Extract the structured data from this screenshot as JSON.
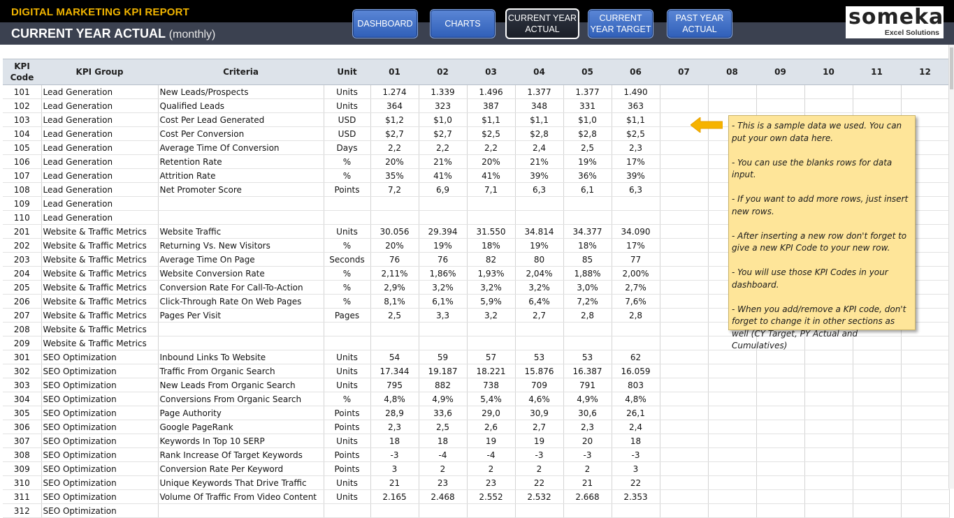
{
  "header": {
    "report_title": "DIGITAL MARKETING KPI REPORT",
    "page_title": "CURRENT YEAR ACTUAL",
    "page_title_suffix": "(monthly)"
  },
  "nav": [
    {
      "label": "DASHBOARD",
      "active": false
    },
    {
      "label": "CHARTS",
      "active": false
    },
    {
      "label": "CURRENT YEAR ACTUAL",
      "active": true
    },
    {
      "label": "CURRENT YEAR TARGET",
      "active": false
    },
    {
      "label": "PAST YEAR ACTUAL",
      "active": false
    }
  ],
  "logo": {
    "word": "someka",
    "tagline": "Excel Solutions"
  },
  "columns": {
    "code": "KPI Code",
    "group": "KPI Group",
    "criteria": "Criteria",
    "unit": "Unit",
    "months": [
      "01",
      "02",
      "03",
      "04",
      "05",
      "06",
      "07",
      "08",
      "09",
      "10",
      "11",
      "12"
    ]
  },
  "rows": [
    {
      "code": "101",
      "group": "Lead Generation",
      "criteria": "New Leads/Prospects",
      "unit": "Units",
      "values": [
        "1.274",
        "1.339",
        "1.496",
        "1.377",
        "1.377",
        "1.490"
      ]
    },
    {
      "code": "102",
      "group": "Lead Generation",
      "criteria": "Qualified Leads",
      "unit": "Units",
      "values": [
        "364",
        "323",
        "387",
        "348",
        "331",
        "363"
      ]
    },
    {
      "code": "103",
      "group": "Lead Generation",
      "criteria": "Cost Per Lead Generated",
      "unit": "USD",
      "values": [
        "$1,2",
        "$1,0",
        "$1,1",
        "$1,1",
        "$1,0",
        "$1,1"
      ]
    },
    {
      "code": "104",
      "group": "Lead Generation",
      "criteria": "Cost Per Conversion",
      "unit": "USD",
      "values": [
        "$2,7",
        "$2,7",
        "$2,5",
        "$2,8",
        "$2,8",
        "$2,5"
      ]
    },
    {
      "code": "105",
      "group": "Lead Generation",
      "criteria": "Average Time Of Conversion",
      "unit": "Days",
      "values": [
        "2,2",
        "2,2",
        "2,2",
        "2,4",
        "2,5",
        "2,3"
      ]
    },
    {
      "code": "106",
      "group": "Lead Generation",
      "criteria": "Retention Rate",
      "unit": "%",
      "values": [
        "20%",
        "21%",
        "20%",
        "21%",
        "19%",
        "17%"
      ]
    },
    {
      "code": "107",
      "group": "Lead Generation",
      "criteria": "Attrition Rate",
      "unit": "%",
      "values": [
        "35%",
        "41%",
        "41%",
        "39%",
        "36%",
        "39%"
      ]
    },
    {
      "code": "108",
      "group": "Lead Generation",
      "criteria": "Net Promoter Score",
      "unit": "Points",
      "values": [
        "7,2",
        "6,9",
        "7,1",
        "6,3",
        "6,1",
        "6,3"
      ]
    },
    {
      "code": "109",
      "group": "Lead Generation",
      "criteria": "",
      "unit": "",
      "values": [
        "",
        "",
        "",
        "",
        "",
        ""
      ]
    },
    {
      "code": "110",
      "group": "Lead Generation",
      "criteria": "",
      "unit": "",
      "values": [
        "",
        "",
        "",
        "",
        "",
        ""
      ]
    },
    {
      "code": "201",
      "group": "Website & Traffic Metrics",
      "criteria": "Website Traffic",
      "unit": "Units",
      "values": [
        "30.056",
        "29.394",
        "31.550",
        "34.814",
        "34.377",
        "34.090"
      ]
    },
    {
      "code": "202",
      "group": "Website & Traffic Metrics",
      "criteria": "Returning Vs. New Visitors",
      "unit": "%",
      "values": [
        "20%",
        "19%",
        "18%",
        "19%",
        "18%",
        "17%"
      ]
    },
    {
      "code": "203",
      "group": "Website & Traffic Metrics",
      "criteria": "Average Time On Page",
      "unit": "Seconds",
      "values": [
        "76",
        "76",
        "82",
        "80",
        "85",
        "77"
      ]
    },
    {
      "code": "204",
      "group": "Website & Traffic Metrics",
      "criteria": "Website Conversion Rate",
      "unit": "%",
      "values": [
        "2,11%",
        "1,86%",
        "1,93%",
        "2,04%",
        "1,88%",
        "2,00%"
      ]
    },
    {
      "code": "205",
      "group": "Website & Traffic Metrics",
      "criteria": "Conversion Rate For Call-To-Action",
      "unit": "%",
      "values": [
        "2,9%",
        "3,2%",
        "3,2%",
        "3,2%",
        "3,0%",
        "2,7%"
      ]
    },
    {
      "code": "206",
      "group": "Website & Traffic Metrics",
      "criteria": "Click-Through Rate On Web Pages",
      "unit": "%",
      "values": [
        "8,1%",
        "6,1%",
        "5,9%",
        "6,4%",
        "7,2%",
        "7,6%"
      ]
    },
    {
      "code": "207",
      "group": "Website & Traffic Metrics",
      "criteria": "Pages Per Visit",
      "unit": "Pages",
      "values": [
        "2,5",
        "3,3",
        "3,2",
        "2,7",
        "2,8",
        "2,8"
      ]
    },
    {
      "code": "208",
      "group": "Website & Traffic Metrics",
      "criteria": "",
      "unit": "",
      "values": [
        "",
        "",
        "",
        "",
        "",
        ""
      ]
    },
    {
      "code": "209",
      "group": "Website & Traffic Metrics",
      "criteria": "",
      "unit": "",
      "values": [
        "",
        "",
        "",
        "",
        "",
        ""
      ]
    },
    {
      "code": "301",
      "group": "SEO Optimization",
      "criteria": "Inbound Links To Website",
      "unit": "Units",
      "values": [
        "54",
        "59",
        "57",
        "53",
        "53",
        "62"
      ]
    },
    {
      "code": "302",
      "group": "SEO Optimization",
      "criteria": "Traffic From Organic Search",
      "unit": "Units",
      "values": [
        "17.344",
        "19.187",
        "18.221",
        "15.876",
        "16.387",
        "16.059"
      ]
    },
    {
      "code": "303",
      "group": "SEO Optimization",
      "criteria": "New Leads From Organic Search",
      "unit": "Units",
      "values": [
        "795",
        "882",
        "738",
        "709",
        "791",
        "803"
      ]
    },
    {
      "code": "304",
      "group": "SEO Optimization",
      "criteria": "Conversions From Organic Search",
      "unit": "%",
      "values": [
        "4,8%",
        "4,9%",
        "5,4%",
        "4,6%",
        "4,9%",
        "4,8%"
      ]
    },
    {
      "code": "305",
      "group": "SEO Optimization",
      "criteria": "Page Authority",
      "unit": "Points",
      "values": [
        "28,9",
        "33,6",
        "29,0",
        "30,9",
        "30,6",
        "26,1"
      ]
    },
    {
      "code": "306",
      "group": "SEO Optimization",
      "criteria": "Google PageRank",
      "unit": "Points",
      "values": [
        "2,3",
        "2,5",
        "2,6",
        "2,7",
        "2,3",
        "2,4"
      ]
    },
    {
      "code": "307",
      "group": "SEO Optimization",
      "criteria": "Keywords In Top 10 SERP",
      "unit": "Units",
      "values": [
        "18",
        "18",
        "19",
        "19",
        "20",
        "18"
      ]
    },
    {
      "code": "308",
      "group": "SEO Optimization",
      "criteria": "Rank Increase Of Target Keywords",
      "unit": "Points",
      "values": [
        "-3",
        "-4",
        "-4",
        "-3",
        "-3",
        "-3"
      ]
    },
    {
      "code": "309",
      "group": "SEO Optimization",
      "criteria": "Conversion Rate Per Keyword",
      "unit": "Points",
      "values": [
        "3",
        "2",
        "2",
        "2",
        "2",
        "3"
      ]
    },
    {
      "code": "310",
      "group": "SEO Optimization",
      "criteria": "Unique Keywords That Drive Traffic",
      "unit": "Units",
      "values": [
        "21",
        "23",
        "23",
        "22",
        "21",
        "22"
      ]
    },
    {
      "code": "311",
      "group": "SEO Optimization",
      "criteria": "Volume Of Traffic From Video Content",
      "unit": "Units",
      "values": [
        "2.165",
        "2.468",
        "2.552",
        "2.532",
        "2.668",
        "2.353"
      ]
    },
    {
      "code": "312",
      "group": "SEO Optimization",
      "criteria": "",
      "unit": "",
      "values": [
        "",
        "",
        "",
        "",
        "",
        ""
      ]
    }
  ],
  "callout": [
    "- This is a sample data we used. You can put your own data here.",
    "- You can use the blanks rows for data input.",
    "- If you want to add more rows, just insert new rows.",
    "- After inserting a new row don't forget to give a new KPI Code to your new row.",
    "- You will use those KPI Codes in your dashboard.",
    "- When you add/remove a KPI code, don't forget to change it in other sections as well (CY Target, PY Actual and Cumulatives)"
  ],
  "colors": {
    "accent": "#f0b400",
    "header_bg": "#000000",
    "subheader_bg": "#3b4150",
    "button": "#2f5fb8",
    "callout_bg": "#fee599",
    "arrow": "#f6b300"
  },
  "icons": {
    "arrow": "arrow-left-icon"
  }
}
